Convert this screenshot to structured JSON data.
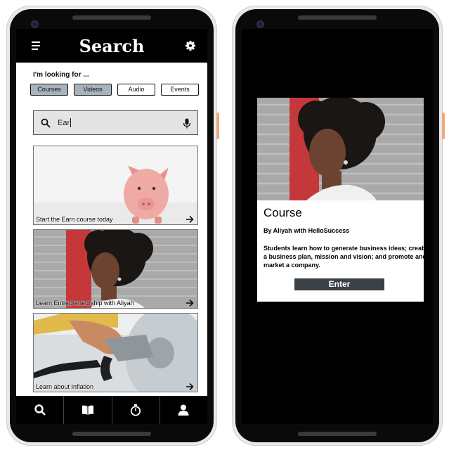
{
  "left_phone": {
    "header": {
      "title": "Search"
    },
    "prompt": "I'm looking for ...",
    "filters": [
      {
        "label": "Courses",
        "active": true
      },
      {
        "label": "Videos",
        "active": true
      },
      {
        "label": "Audio",
        "active": false
      },
      {
        "label": "Events",
        "active": false
      }
    ],
    "search": {
      "value": "Ear"
    },
    "cards": [
      {
        "caption": "Start the Earn course today",
        "image": "piggy-bank"
      },
      {
        "caption": "Learn Entrepreneurship with Aliyah",
        "image": "portrait-woman"
      },
      {
        "caption": "Learn about Inflation",
        "image": "fuel-pump"
      }
    ],
    "tabbar": [
      "search-icon",
      "book-icon",
      "stopwatch-icon",
      "profile-icon"
    ]
  },
  "right_phone": {
    "course": {
      "title": "Course",
      "author": "By Aliyah with HelloSuccess",
      "description": "Students learn how to generate business ideas; create a business plan, mission and vision; and promote and market a company.",
      "button": "Enter"
    }
  },
  "colors": {
    "chip_active": "#a7b2be",
    "button_dark": "#3b4146",
    "accent_side": "#f0a878"
  }
}
